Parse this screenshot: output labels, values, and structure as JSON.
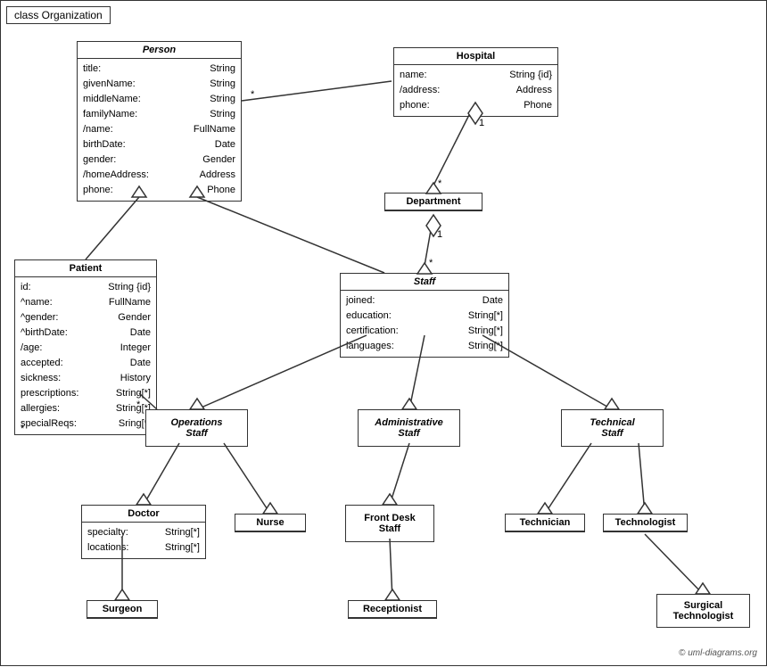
{
  "diagram": {
    "title": "class Organization",
    "copyright": "© uml-diagrams.org",
    "classes": {
      "person": {
        "name": "Person",
        "italic": true,
        "attrs": [
          {
            "attr": "title:",
            "type": "String"
          },
          {
            "attr": "givenName:",
            "type": "String"
          },
          {
            "attr": "middleName:",
            "type": "String"
          },
          {
            "attr": "familyName:",
            "type": "String"
          },
          {
            "attr": "/name:",
            "type": "FullName"
          },
          {
            "attr": "birthDate:",
            "type": "Date"
          },
          {
            "attr": "gender:",
            "type": "Gender"
          },
          {
            "attr": "/homeAddress:",
            "type": "Address"
          },
          {
            "attr": "phone:",
            "type": "Phone"
          }
        ]
      },
      "hospital": {
        "name": "Hospital",
        "italic": false,
        "attrs": [
          {
            "attr": "name:",
            "type": "String {id}"
          },
          {
            "attr": "/address:",
            "type": "Address"
          },
          {
            "attr": "phone:",
            "type": "Phone"
          }
        ]
      },
      "department": {
        "name": "Department",
        "italic": false,
        "attrs": []
      },
      "staff": {
        "name": "Staff",
        "italic": true,
        "attrs": [
          {
            "attr": "joined:",
            "type": "Date"
          },
          {
            "attr": "education:",
            "type": "String[*]"
          },
          {
            "attr": "certification:",
            "type": "String[*]"
          },
          {
            "attr": "languages:",
            "type": "String[*]"
          }
        ]
      },
      "patient": {
        "name": "Patient",
        "italic": false,
        "attrs": [
          {
            "attr": "id:",
            "type": "String {id}"
          },
          {
            "attr": "^name:",
            "type": "FullName"
          },
          {
            "attr": "^gender:",
            "type": "Gender"
          },
          {
            "attr": "^birthDate:",
            "type": "Date"
          },
          {
            "attr": "/age:",
            "type": "Integer"
          },
          {
            "attr": "accepted:",
            "type": "Date"
          },
          {
            "attr": "sickness:",
            "type": "History"
          },
          {
            "attr": "prescriptions:",
            "type": "String[*]"
          },
          {
            "attr": "allergies:",
            "type": "String[*]"
          },
          {
            "attr": "specialReqs:",
            "type": "Sring[*]"
          }
        ]
      },
      "operations_staff": {
        "name": "Operations Staff",
        "italic": true
      },
      "administrative_staff": {
        "name": "Administrative Staff",
        "italic": true
      },
      "technical_staff": {
        "name": "Technical Staff",
        "italic": true
      },
      "doctor": {
        "name": "Doctor",
        "italic": false,
        "attrs": [
          {
            "attr": "specialty:",
            "type": "String[*]"
          },
          {
            "attr": "locations:",
            "type": "String[*]"
          }
        ]
      },
      "nurse": {
        "name": "Nurse",
        "italic": false,
        "attrs": []
      },
      "front_desk_staff": {
        "name": "Front Desk Staff",
        "italic": false,
        "attrs": []
      },
      "technician": {
        "name": "Technician",
        "italic": false,
        "attrs": []
      },
      "technologist": {
        "name": "Technologist",
        "italic": false,
        "attrs": []
      },
      "surgeon": {
        "name": "Surgeon",
        "italic": false,
        "attrs": []
      },
      "receptionist": {
        "name": "Receptionist",
        "italic": false,
        "attrs": []
      },
      "surgical_technologist": {
        "name": "Surgical Technologist",
        "italic": false,
        "attrs": []
      }
    }
  }
}
